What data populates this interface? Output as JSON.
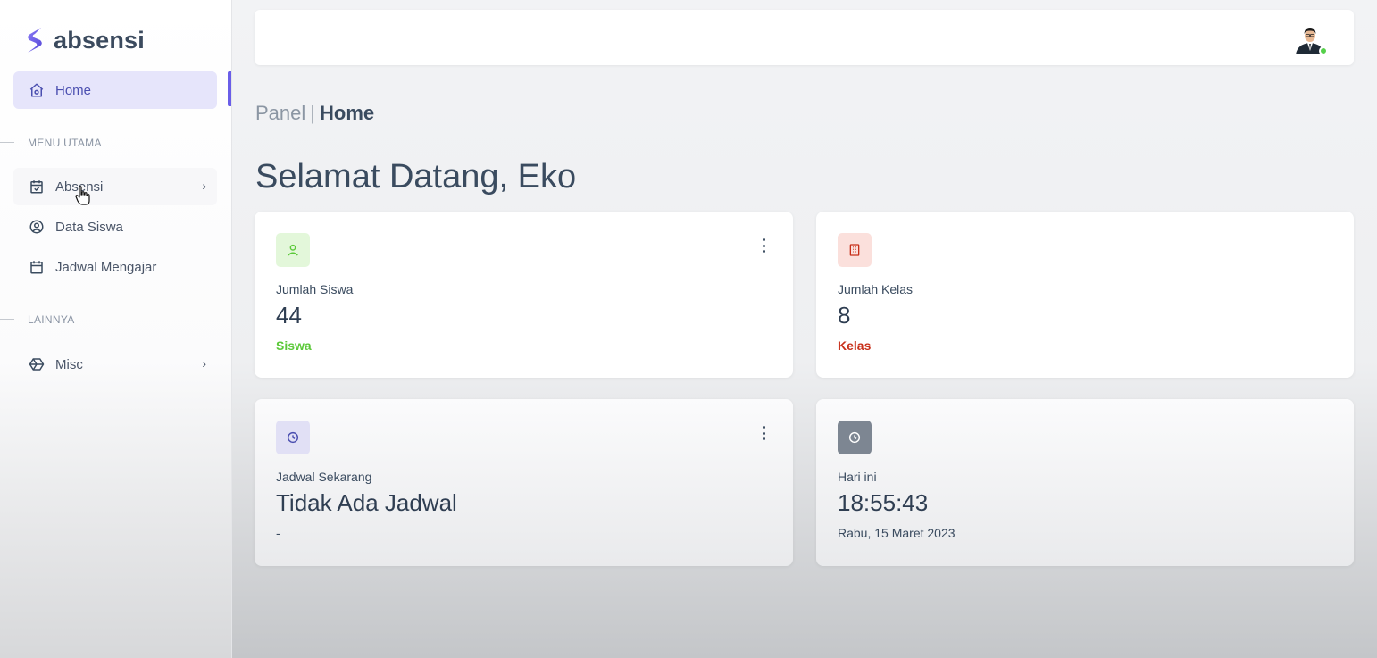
{
  "app": {
    "logo_text": "absensi",
    "accent_color": "#6a5ee8"
  },
  "sidebar": {
    "home": {
      "label": "Home",
      "icon": "home-icon"
    },
    "section_main": "MENU UTAMA",
    "items_main": [
      {
        "label": "Absensi",
        "icon": "calendar-check-icon",
        "has_submenu": true
      },
      {
        "label": "Data Siswa",
        "icon": "user-circle-icon",
        "has_submenu": false
      },
      {
        "label": "Jadwal Mengajar",
        "icon": "calendar-icon",
        "has_submenu": false
      }
    ],
    "section_other": "LAINNYA",
    "items_other": [
      {
        "label": "Misc",
        "icon": "box-icon",
        "has_submenu": true
      }
    ]
  },
  "breadcrumb": {
    "parent": "Panel",
    "separator": "|",
    "current": "Home"
  },
  "page": {
    "title": "Selamat Datang, Eko"
  },
  "cards": [
    {
      "icon": "user-icon",
      "label": "Jumlah Siswa",
      "value": "44",
      "sub": "Siswa",
      "sub_color": "#5cc93a",
      "icon_bg": "#e3f7da",
      "icon_color": "#5cc93a"
    },
    {
      "icon": "building-icon",
      "label": "Jumlah Kelas",
      "value": "8",
      "sub": "Kelas",
      "sub_color": "#c8301a",
      "icon_bg": "#fbe0dc",
      "icon_color": "#c8301a"
    },
    {
      "icon": "clock-icon",
      "label": "Jadwal Sekarang",
      "value": "Tidak Ada Jadwal",
      "sub": "-",
      "icon_bg": "#e1e0f5",
      "icon_color": "#4b4fb0"
    },
    {
      "icon": "clock-icon",
      "label": "Hari ini",
      "value": "18:55:43",
      "sub": "Rabu, 15 Maret 2023",
      "icon_bg": "#7d8692",
      "icon_color": "#ffffff"
    }
  ]
}
